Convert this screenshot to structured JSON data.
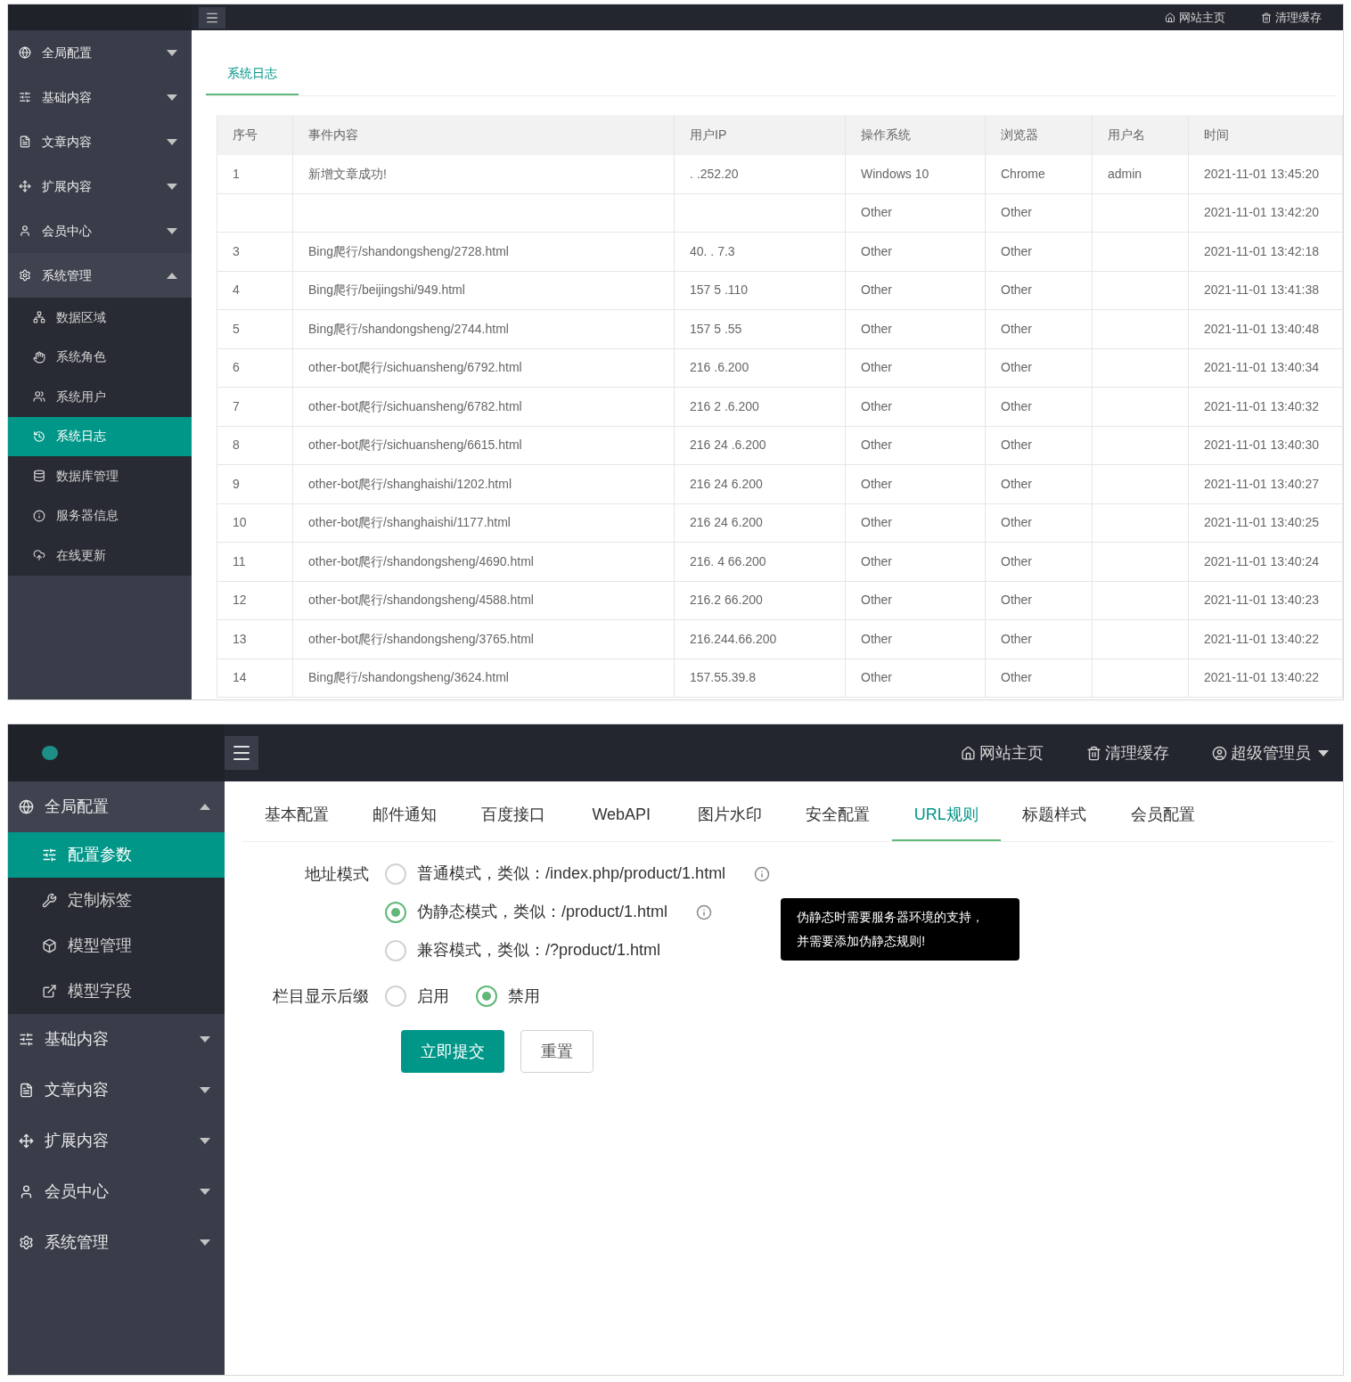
{
  "log_screen": {
    "topbar": {
      "links": [
        {
          "label": "网站主页"
        },
        {
          "label": "清理缓存"
        }
      ]
    },
    "sidebar": [
      {
        "label": "全局配置",
        "expanded": false
      },
      {
        "label": "基础内容",
        "expanded": false
      },
      {
        "label": "文章内容",
        "expanded": false
      },
      {
        "label": "扩展内容",
        "expanded": false
      },
      {
        "label": "会员中心",
        "expanded": false
      },
      {
        "label": "系统管理",
        "expanded": true,
        "children": [
          {
            "label": "数据区域",
            "selected": false
          },
          {
            "label": "系统角色",
            "selected": false
          },
          {
            "label": "系统用户",
            "selected": false
          },
          {
            "label": "系统日志",
            "selected": true
          },
          {
            "label": "数据库管理",
            "selected": false
          },
          {
            "label": "服务器信息",
            "selected": false
          },
          {
            "label": "在线更新",
            "selected": false
          }
        ]
      }
    ],
    "tabs": [
      {
        "label": "系统日志",
        "selected": true
      }
    ],
    "table": {
      "columns": [
        "序号",
        "事件内容",
        "用户IP",
        "操作系统",
        "浏览器",
        "用户名",
        "时间"
      ],
      "rows": [
        [
          "1",
          "新增文章成功!",
          ". .252.20",
          "Windows 10",
          "Chrome",
          "admin",
          "2021-11-01 13:45:20"
        ],
        [
          "",
          "",
          "",
          "Other",
          "Other",
          "",
          "2021-11-01 13:42:20"
        ],
        [
          "3",
          "Bing爬行/shandongsheng/2728.html",
          "40. . 7.3",
          "Other",
          "Other",
          "",
          "2021-11-01 13:42:18"
        ],
        [
          "4",
          "Bing爬行/beijingshi/949.html",
          "157 5 .110",
          "Other",
          "Other",
          "",
          "2021-11-01 13:41:38"
        ],
        [
          "5",
          "Bing爬行/shandongsheng/2744.html",
          "157 5 .55",
          "Other",
          "Other",
          "",
          "2021-11-01 13:40:48"
        ],
        [
          "6",
          "other-bot爬行/sichuansheng/6792.html",
          "216 .6.200",
          "Other",
          "Other",
          "",
          "2021-11-01 13:40:34"
        ],
        [
          "7",
          "other-bot爬行/sichuansheng/6782.html",
          "216 2 .6.200",
          "Other",
          "Other",
          "",
          "2021-11-01 13:40:32"
        ],
        [
          "8",
          "other-bot爬行/sichuansheng/6615.html",
          "216 24 .6.200",
          "Other",
          "Other",
          "",
          "2021-11-01 13:40:30"
        ],
        [
          "9",
          "other-bot爬行/shanghaishi/1202.html",
          "216 24 6.200",
          "Other",
          "Other",
          "",
          "2021-11-01 13:40:27"
        ],
        [
          "10",
          "other-bot爬行/shanghaishi/1177.html",
          "216 24 6.200",
          "Other",
          "Other",
          "",
          "2021-11-01 13:40:25"
        ],
        [
          "11",
          "other-bot爬行/shandongsheng/4690.html",
          "216. 4 66.200",
          "Other",
          "Other",
          "",
          "2021-11-01 13:40:24"
        ],
        [
          "12",
          "other-bot爬行/shandongsheng/4588.html",
          "216.2 66.200",
          "Other",
          "Other",
          "",
          "2021-11-01 13:40:23"
        ],
        [
          "13",
          "other-bot爬行/shandongsheng/3765.html",
          "216.244.66.200",
          "Other",
          "Other",
          "",
          "2021-11-01 13:40:22"
        ],
        [
          "14",
          "Bing爬行/shandongsheng/3624.html",
          "157.55.39.8",
          "Other",
          "Other",
          "",
          "2021-11-01 13:40:22"
        ]
      ]
    }
  },
  "config_screen": {
    "topbar": {
      "links": [
        {
          "label": "网站主页"
        },
        {
          "label": "清理缓存"
        },
        {
          "label": "超级管理员"
        }
      ]
    },
    "sidebar": [
      {
        "label": "全局配置",
        "expanded": true,
        "children": [
          {
            "label": "配置参数",
            "selected": true
          },
          {
            "label": "定制标签",
            "selected": false
          },
          {
            "label": "模型管理",
            "selected": false
          },
          {
            "label": "模型字段",
            "selected": false
          }
        ]
      },
      {
        "label": "基础内容",
        "expanded": false
      },
      {
        "label": "文章内容",
        "expanded": false
      },
      {
        "label": "扩展内容",
        "expanded": false
      },
      {
        "label": "会员中心",
        "expanded": false
      },
      {
        "label": "系统管理",
        "expanded": false
      }
    ],
    "tabs": [
      {
        "label": "基本配置",
        "selected": false
      },
      {
        "label": "邮件通知",
        "selected": false
      },
      {
        "label": "百度接口",
        "selected": false
      },
      {
        "label": "WebAPI",
        "selected": false
      },
      {
        "label": "图片水印",
        "selected": false
      },
      {
        "label": "安全配置",
        "selected": false
      },
      {
        "label": "URL规则",
        "selected": true
      },
      {
        "label": "标题样式",
        "selected": false
      },
      {
        "label": "会员配置",
        "selected": false
      }
    ],
    "fields": [
      {
        "label": "地址模式",
        "kind": "stacked",
        "options": [
          {
            "label": "普通模式，类似：/index.php/product/1.html",
            "selected": false,
            "info": true
          },
          {
            "label": "伪静态模式，类似：/product/1.html",
            "selected": true,
            "info": true,
            "tooltip": [
              "伪静态时需要服务器环境的支持，",
              "并需要添加伪静态规则!"
            ]
          },
          {
            "label": "兼容模式，类似：/?product/1.html",
            "selected": false,
            "info": false
          }
        ]
      },
      {
        "label": "栏目显示后缀",
        "kind": "inline",
        "options": [
          {
            "label": "启用",
            "selected": false,
            "info": false
          },
          {
            "label": "禁用",
            "selected": true,
            "info": false
          }
        ]
      }
    ],
    "buttons": [
      {
        "label": "立即提交",
        "kind": "primary"
      },
      {
        "label": "重置",
        "kind": "default"
      }
    ]
  }
}
